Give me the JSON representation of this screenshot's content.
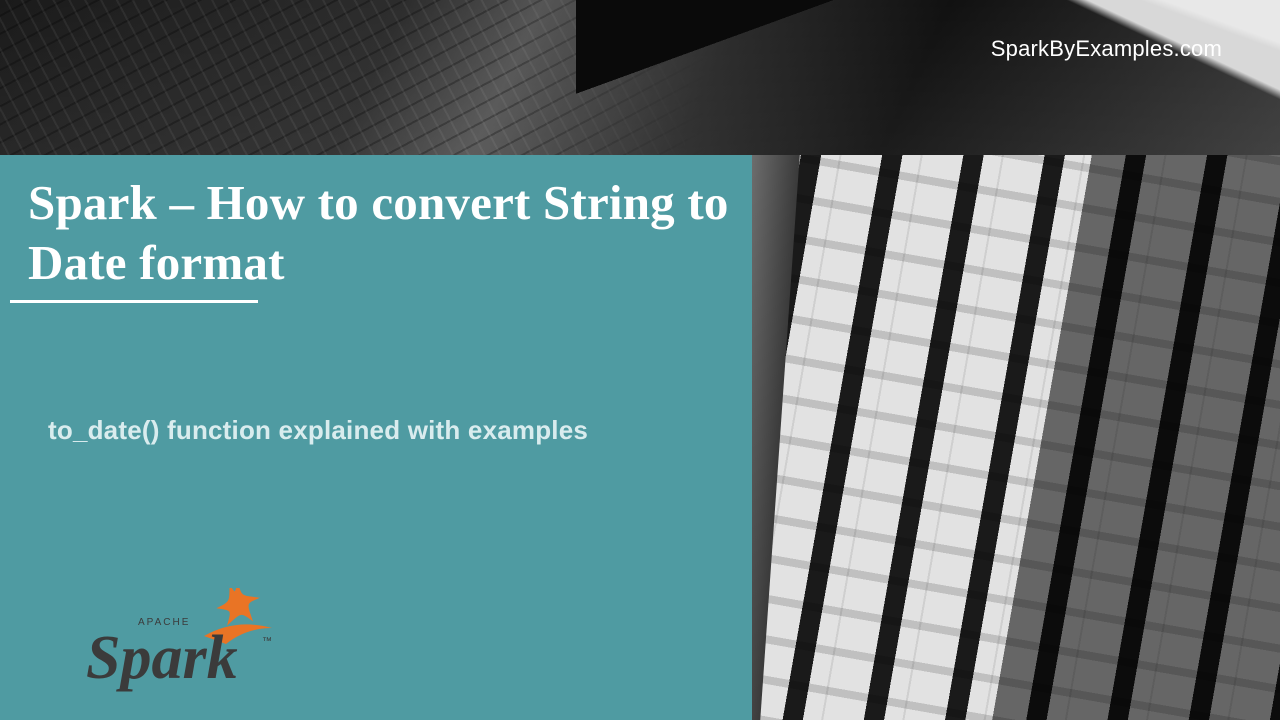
{
  "site": {
    "label": "SparkByExamples.com"
  },
  "panel": {
    "title": "Spark – How to convert String to Date format",
    "subtitle": "to_date() function explained with examples"
  },
  "logo": {
    "apache_text": "APACHE",
    "name": "Spark",
    "trademark": "™"
  },
  "colors": {
    "panel_bg": "#4f9ba2",
    "title_text": "#ffffff",
    "subtitle_text": "#d9ecee",
    "logo_star": "#e97425",
    "logo_text": "#3b3b3b"
  }
}
